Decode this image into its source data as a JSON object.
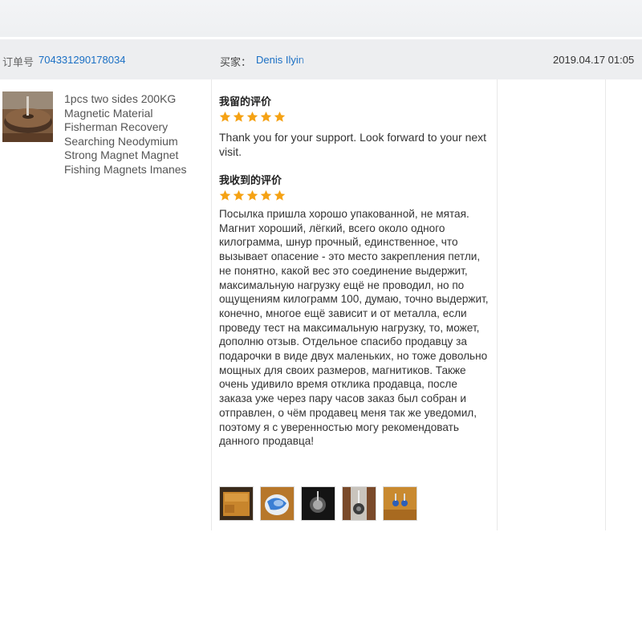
{
  "order": {
    "label": "订单号",
    "number": "704331290178034",
    "buyer_label": "买家：",
    "buyer_name": "Denis Ilyin",
    "datetime": "2019.04.17 01:05"
  },
  "product": {
    "title": "1pcs two sides 200KG Magnetic Material Fisherman Recovery Searching Neodymium Strong Magnet Magnet Fishing Magnets Imanes",
    "thumbnail_icon": "magnet-product-photo"
  },
  "left_review": {
    "heading": "我留的评价",
    "rating": 5,
    "text": "Thank you for your support. Look forward to your next visit."
  },
  "received_review": {
    "heading": "我收到的评价",
    "rating": 5,
    "text": "Посылка пришла хорошо упакованной, не мятая. Магнит хороший, лёгкий, всего около одного килограмма, шнур прочный, единственное, что вызывает опасение - это место закрепления петли, не понятно, какой вес это соединение выдержит, максимальную нагрузку ещё не проводил, но по ощущениям килограмм 100, думаю, точно выдержит, конечно, многое ещё зависит и от металла, если проведу тест на максимальную нагрузку, то, может, дополню отзыв. Отдельное спасибо продавцу за подарочки в виде двух маленьких, но тоже довольно мощных для своих размеров, магнитиков. Также очень удивило время отклика продавца, после заказа уже через пару часов заказ был собран и отправлен, о чём продавец меня так же уведомил, поэтому я с уверенностью могу рекомендовать данного продавца!",
    "photos": [
      {
        "icon": "package-box-photo"
      },
      {
        "icon": "wrapped-magnet-photo"
      },
      {
        "icon": "magnet-dark-photo"
      },
      {
        "icon": "magnet-hook-photo"
      },
      {
        "icon": "small-magnets-photo"
      }
    ]
  },
  "colors": {
    "link": "#1a6fc4",
    "star": "#f5a214",
    "header_bg": "#edeef0"
  }
}
